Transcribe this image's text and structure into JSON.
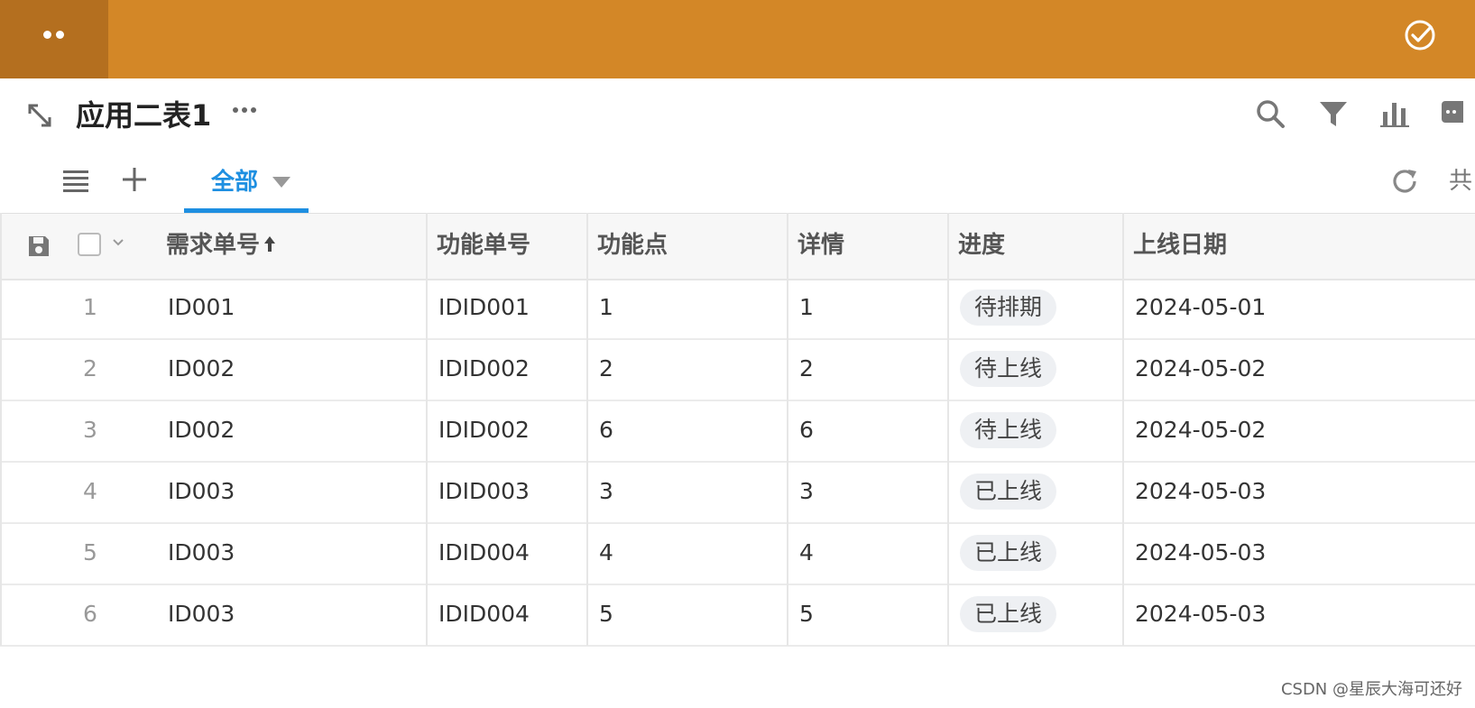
{
  "header": {
    "title": "应用二表1"
  },
  "tabs": {
    "active_label": "全部",
    "share_label": "共"
  },
  "table": {
    "columns": [
      "需求单号",
      "功能单号",
      "功能点",
      "详情",
      "进度",
      "上线日期"
    ],
    "sort_column": "需求单号",
    "rows": [
      {
        "num": "1",
        "req": "ID001",
        "func": "IDID001",
        "point": "1",
        "detail": "1",
        "status": "待排期",
        "date": "2024-05-01"
      },
      {
        "num": "2",
        "req": "ID002",
        "func": "IDID002",
        "point": "2",
        "detail": "2",
        "status": "待上线",
        "date": "2024-05-02"
      },
      {
        "num": "3",
        "req": "ID002",
        "func": "IDID002",
        "point": "6",
        "detail": "6",
        "status": "待上线",
        "date": "2024-05-02"
      },
      {
        "num": "4",
        "req": "ID003",
        "func": "IDID003",
        "point": "3",
        "detail": "3",
        "status": "已上线",
        "date": "2024-05-03"
      },
      {
        "num": "5",
        "req": "ID003",
        "func": "IDID004",
        "point": "4",
        "detail": "4",
        "status": "已上线",
        "date": "2024-05-03"
      },
      {
        "num": "6",
        "req": "ID003",
        "func": "IDID004",
        "point": "5",
        "detail": "5",
        "status": "已上线",
        "date": "2024-05-03"
      }
    ]
  },
  "watermark": "CSDN @星辰大海可还好",
  "colors": {
    "topbar": "#d38727",
    "topbar_left": "#b46f1f",
    "accent": "#1e8fe1",
    "pill_bg": "#eef0f3"
  },
  "icons": [
    "apps-dots-icon",
    "check-circle-icon",
    "expand-icon",
    "more-icon",
    "search-icon",
    "filter-icon",
    "chart-icon",
    "comment-icon",
    "list-icon",
    "plus-icon",
    "caret-down-icon",
    "refresh-icon",
    "save-icon",
    "sort-up-icon"
  ]
}
